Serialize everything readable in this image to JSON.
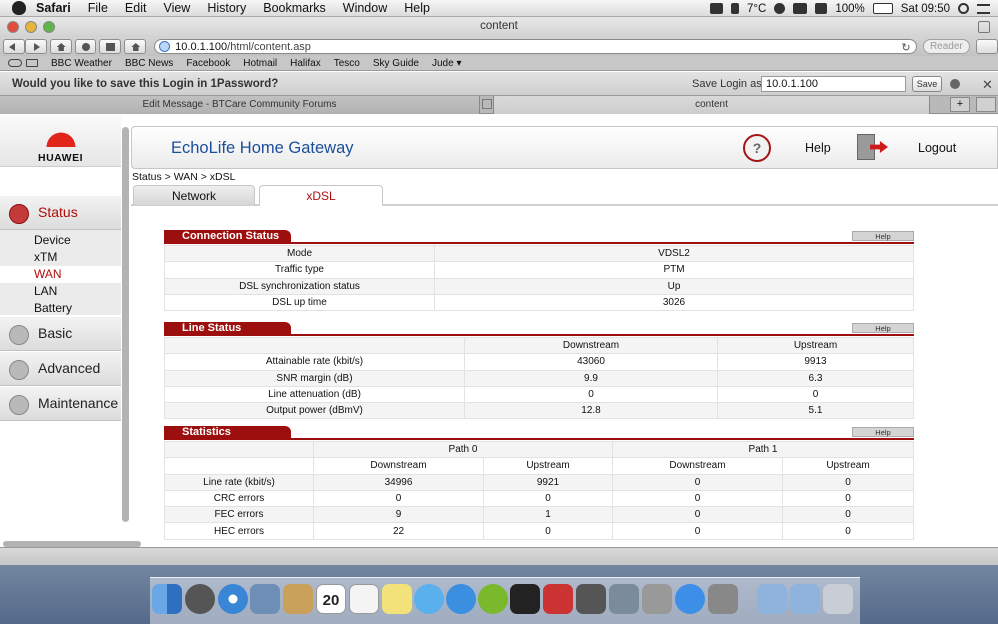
{
  "menubar": {
    "app": "Safari",
    "items": [
      "File",
      "Edit",
      "View",
      "History",
      "Bookmarks",
      "Window",
      "Help"
    ],
    "status": {
      "temp": "7°C",
      "battery": "100%",
      "clock": "Sat 09:50"
    }
  },
  "window": {
    "title": "content"
  },
  "toolbar": {
    "url_host": "10.0.1.100",
    "url_path": "/html/content.asp",
    "reader": "Reader"
  },
  "bookmarks": [
    "BBC Weather",
    "BBC News",
    "Facebook",
    "Hotmail",
    "Halifax",
    "Tesco",
    "Sky Guide",
    "Jude ▾"
  ],
  "onepassword": {
    "question": "Would you like to save this Login in 1Password?",
    "label": "Save Login as",
    "value": "10.0.1.100",
    "save": "Save"
  },
  "tabs": [
    "Edit Message - BTCare Community Forums",
    "content"
  ],
  "sidebar": {
    "brand": "HUAWEI",
    "groups": {
      "status": "Status",
      "basic": "Basic",
      "advanced": "Advanced",
      "maintenance": "Maintenance"
    },
    "status_items": [
      "Device",
      "xTM",
      "WAN",
      "LAN",
      "Battery"
    ]
  },
  "header": {
    "title": "EchoLife Home Gateway",
    "help": "Help",
    "logout": "Logout"
  },
  "breadcrumb": "Status > WAN > xDSL",
  "page_tabs": [
    "Network",
    "xDSL"
  ],
  "connection": {
    "title": "Connection Status",
    "help": "Help",
    "rows": [
      [
        "Mode",
        "VDSL2"
      ],
      [
        "Traffic type",
        "PTM"
      ],
      [
        "DSL synchronization status",
        "Up"
      ],
      [
        "DSL up time",
        "3026"
      ]
    ]
  },
  "line": {
    "title": "Line Status",
    "help": "Help",
    "cols": [
      "Downstream",
      "Upstream"
    ],
    "rows": [
      [
        "Attainable rate (kbit/s)",
        "43060",
        "9913"
      ],
      [
        "SNR margin (dB)",
        "9.9",
        "6.3"
      ],
      [
        "Line attenuation (dB)",
        "0",
        "0"
      ],
      [
        "Output power (dBmV)",
        "12.8",
        "5.1"
      ]
    ]
  },
  "stats": {
    "title": "Statistics",
    "help": "Help",
    "paths": [
      "Path 0",
      "Path 1"
    ],
    "cols": [
      "Downstream",
      "Upstream",
      "Downstream",
      "Upstream"
    ],
    "rows": [
      [
        "Line rate (kbit/s)",
        "34996",
        "9921",
        "0",
        "0"
      ],
      [
        "CRC errors",
        "0",
        "0",
        "0",
        "0"
      ],
      [
        "FEC errors",
        "9",
        "1",
        "0",
        "0"
      ],
      [
        "HEC errors",
        "22",
        "0",
        "0",
        "0"
      ]
    ]
  },
  "dock": {
    "calendar_day": "20"
  }
}
